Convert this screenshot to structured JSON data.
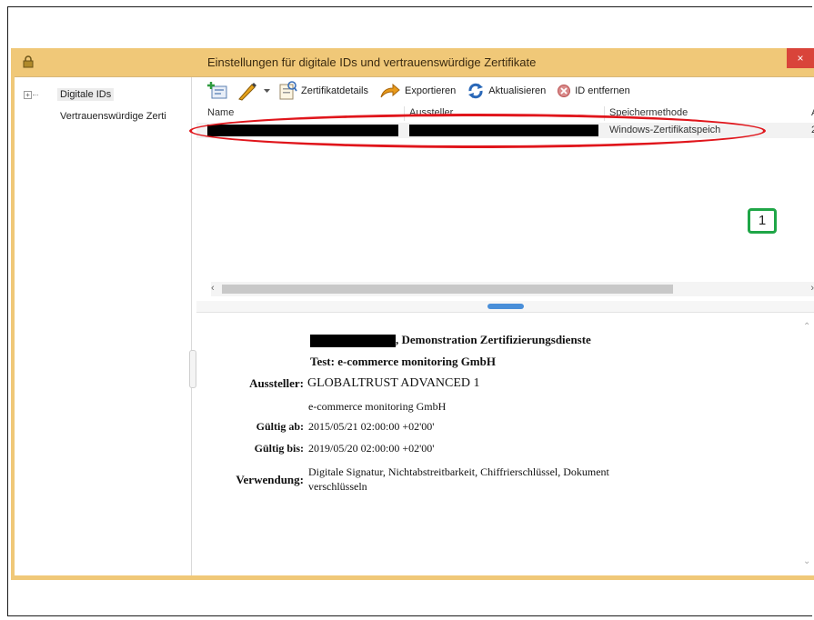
{
  "dialog": {
    "title": "Einstellungen für digitale IDs und vertrauenswürdige Zertifikate",
    "close_symbol": "×"
  },
  "sidebar": {
    "items": [
      {
        "label": "Digitale IDs",
        "expander": "+"
      },
      {
        "label": "Vertrauenswürdige Zerti"
      }
    ]
  },
  "toolbar": {
    "details_label": "Zertifikatdetails",
    "export_label": "Exportieren",
    "refresh_label": "Aktualisieren",
    "remove_label": "ID entfernen"
  },
  "table": {
    "columns": [
      "Name",
      "Aussteller",
      "Speichermethode",
      "A"
    ],
    "row": {
      "store": "Windows-Zertifikatspeich",
      "more": "2"
    }
  },
  "annotation": {
    "badge": "1"
  },
  "details": {
    "subject_suffix": ", Demonstration Zertifizierungsdienste",
    "subject_line2": "Test: e-commerce monitoring GmbH",
    "issuer_label": "Aussteller:",
    "issuer_value": "GLOBALTRUST ADVANCED 1",
    "issuer_org": "e-commerce monitoring GmbH",
    "valid_from_label": "Gültig ab:",
    "valid_from_value": "2015/05/21 02:00:00 +02'00'",
    "valid_to_label": "Gültig bis:",
    "valid_to_value": "2019/05/20 02:00:00 +02'00'",
    "usage_label": "Verwendung:",
    "usage_line1": "Digitale Signatur, Nichtabstreitbarkeit, Chiffrierschlüssel, Dokument",
    "usage_line2": "verschlüsseln"
  },
  "colors": {
    "title_bar": "#f0c878",
    "close_button": "#d9443a",
    "annotation_ellipse": "#e0151b",
    "annotation_badge": "#1fa647"
  }
}
